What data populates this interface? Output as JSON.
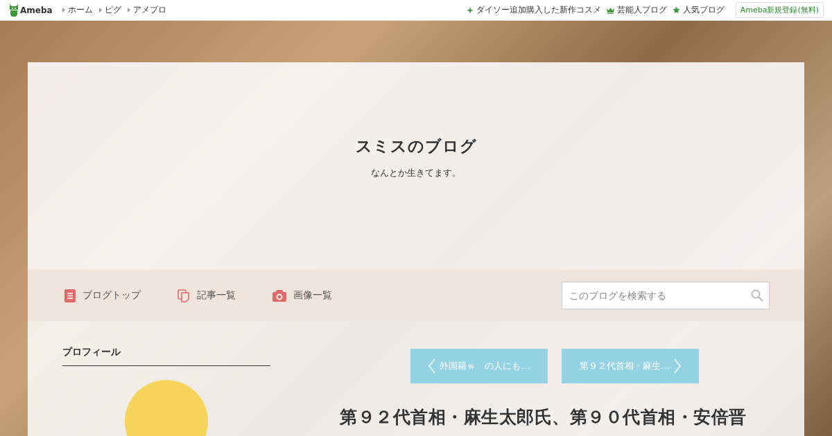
{
  "top_bar": {
    "logo": "Ameba",
    "links": [
      "ホーム",
      "ピグ",
      "アメブロ"
    ],
    "right_links": [
      {
        "kind": "sparkle",
        "label": "ダイソー追加購入した新作コスメ"
      },
      {
        "kind": "crown",
        "label": "芸能人ブログ"
      },
      {
        "kind": "star",
        "label": "人気ブログ"
      }
    ],
    "signup_button": "Ameba新規登録(無料)"
  },
  "blog_header": {
    "title": "スミスのブログ",
    "description": "なんとか生きてます。"
  },
  "blog_nav": {
    "items": [
      {
        "kind": "document",
        "label": "ブログトップ"
      },
      {
        "kind": "pages",
        "label": "記事一覧"
      },
      {
        "kind": "camera",
        "label": "画像一覧"
      }
    ],
    "search": {
      "placeholder": "このブログを検索する"
    }
  },
  "sidebar": {
    "heading": "プロフィール"
  },
  "pager": {
    "previous": "外国籍ｗ　の人にも…",
    "next": "第９２代首相・麻生…"
  },
  "article": {
    "title": "第９２代首相・麻生太郎氏、第９０代首相・安倍晋"
  }
}
